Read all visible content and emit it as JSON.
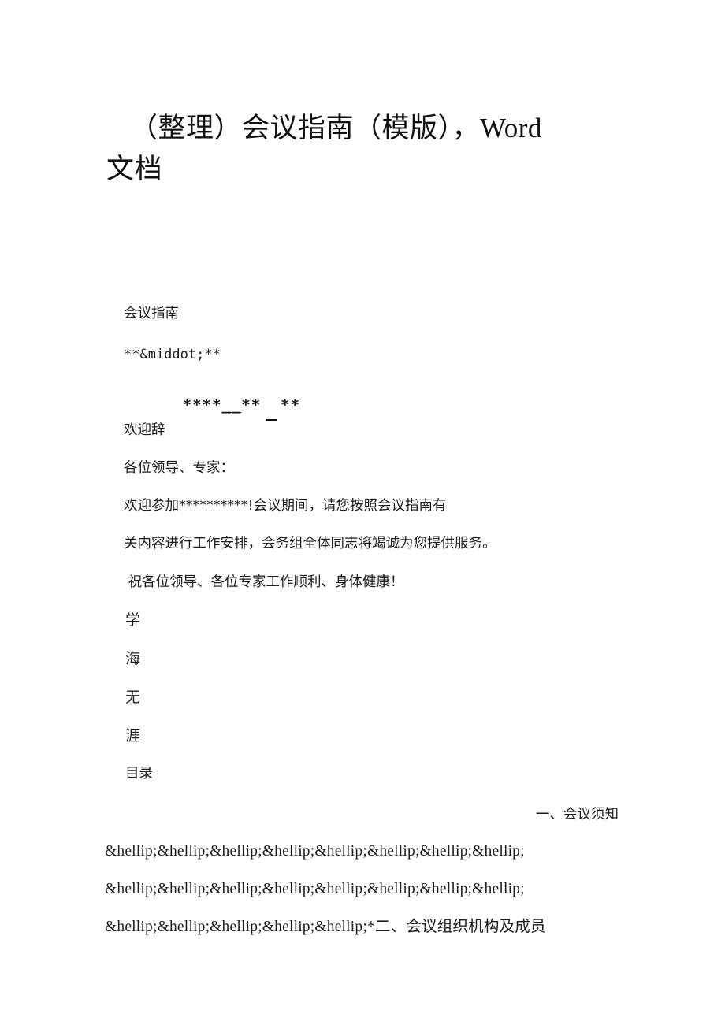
{
  "document": {
    "title_line_1": "（整理）会议指南（模版），Word",
    "title_line_2": "文档"
  },
  "body": {
    "heading": "会议指南",
    "org_placeholder": "**&middot;**",
    "date_placeholder": {
      "year": "****",
      "sep1": "__",
      "month": "**",
      "gap": "  ",
      "day": "**"
    },
    "welcome_heading": "欢迎辞",
    "salutation": "各位领导、专家：",
    "paragraph_1_line_1": "欢迎参加**********!会议期间，请您按照会议指南有",
    "paragraph_1_line_2": "关内容进行工作安排，会务组全体同志将竭诚为您提供服务。",
    "paragraph_2": " 祝各位领导、各位专家工作顺利、身体健康！",
    "watermark_chars": [
      "学",
      "海",
      "无",
      "涯"
    ]
  },
  "toc": {
    "heading": "目录",
    "entry_1_label": "一、会议须知",
    "dots_line_1": "&hellip;&hellip;&hellip;&hellip;&hellip;&hellip;&hellip;&hellip;",
    "dots_line_2": "&hellip;&hellip;&hellip;&hellip;&hellip;&hellip;&hellip;&hellip;",
    "dots_line_3": "&hellip;&hellip;&hellip;&hellip;&hellip;*二、会议组织机构及成员"
  },
  "colors": {
    "page_background": "#ffffff",
    "text": "#1c1c1c",
    "title_text": "#111111"
  }
}
